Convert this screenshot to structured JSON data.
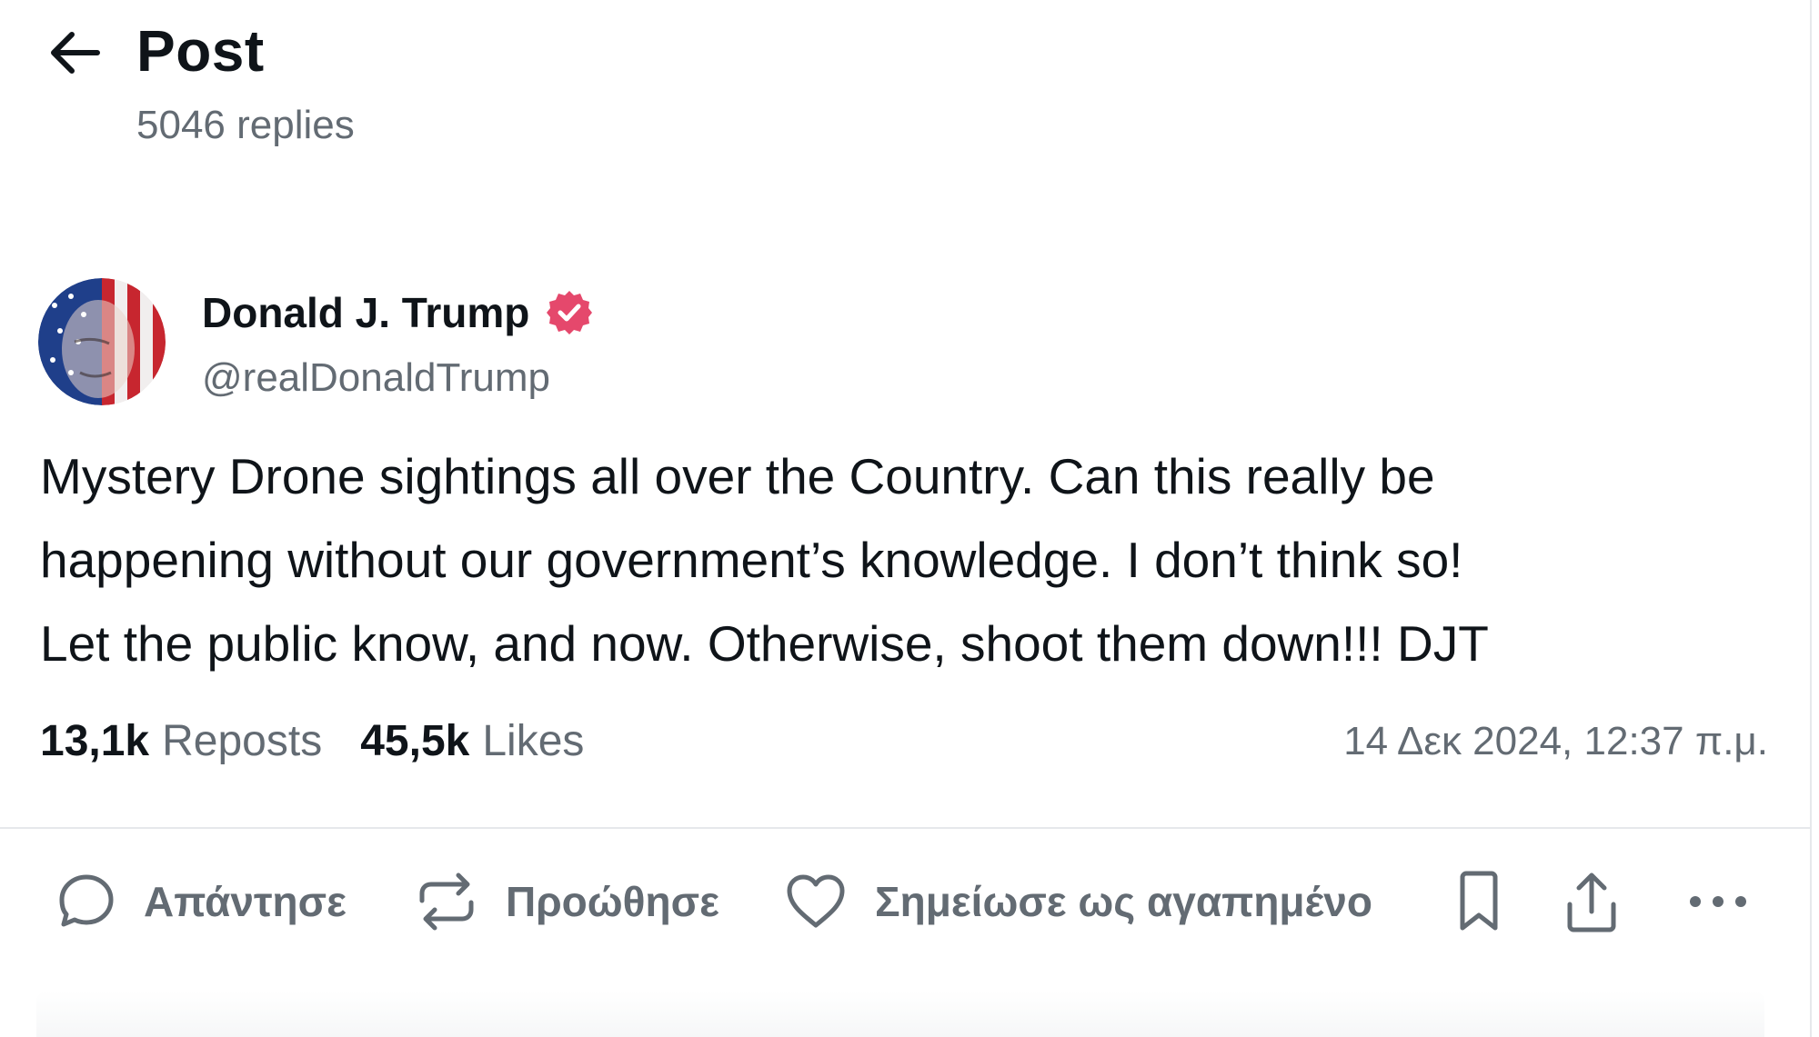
{
  "header": {
    "title": "Post",
    "replies": "5046 replies"
  },
  "author": {
    "name": "Donald J. Trump",
    "handle": "@realDonaldTrump"
  },
  "post": {
    "lines": [
      "Mystery Drone sightings all over the Country. Can this really be",
      "happening without our government’s knowledge. I don’t think so!",
      "Let the public know, and now. Otherwise, shoot them down!!! DJT"
    ]
  },
  "stats": {
    "reposts_count": "13,1k",
    "reposts_label": "Reposts",
    "likes_count": "45,5k",
    "likes_label": "Likes",
    "timestamp": "14 Δεκ 2024, 12:37 π.μ."
  },
  "actions": {
    "reply": "Απάντησε",
    "repost": "Προώθησε",
    "like": "Σημείωσε ως αγαπημένο"
  },
  "colors": {
    "text": "#0f1419",
    "muted": "#636b73",
    "verified": "#e5486c"
  }
}
